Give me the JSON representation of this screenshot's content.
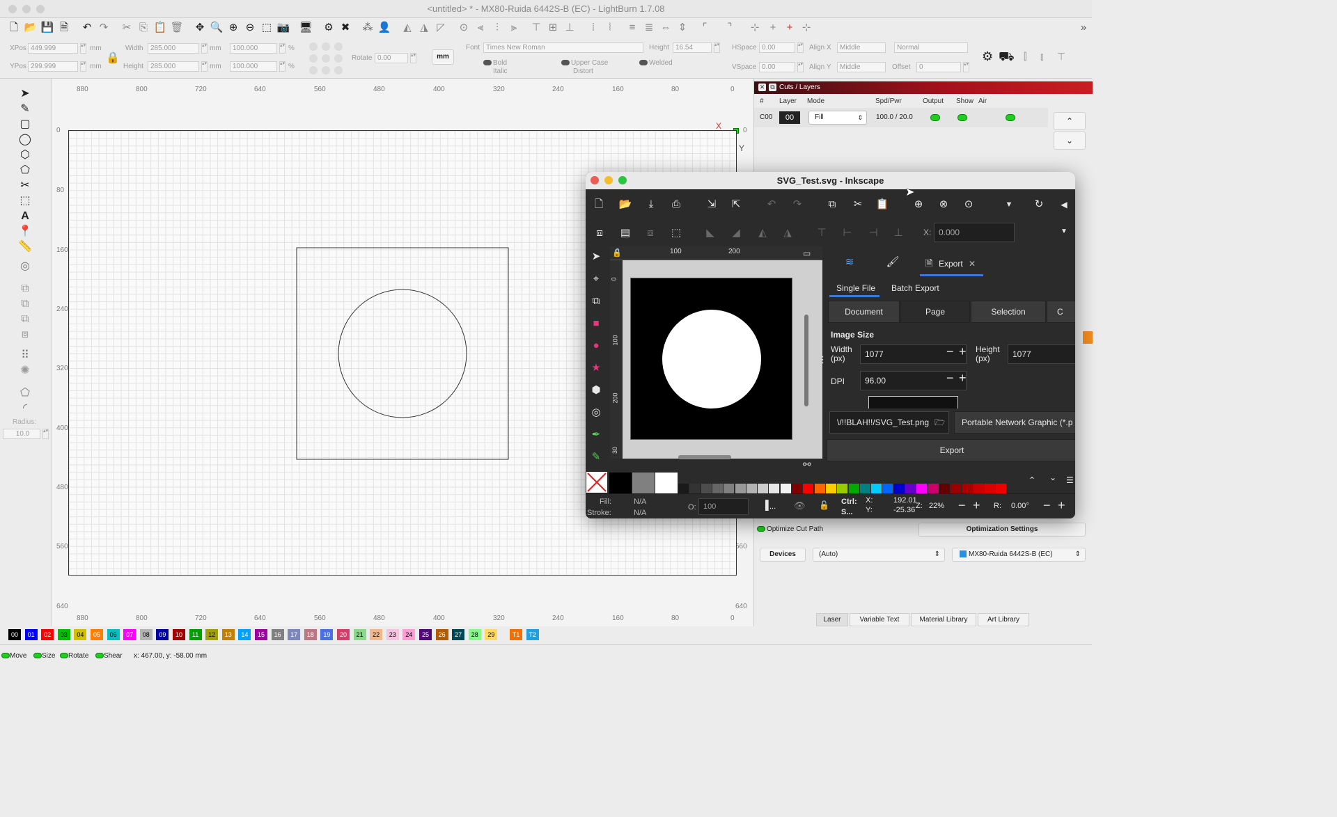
{
  "lightburn": {
    "title": "<untitled> * - MX80-Ruida 6442S-B (EC) - LightBurn 1.7.08",
    "numbar": {
      "xpos_label": "XPos",
      "xpos": "449.999",
      "ypos_label": "YPos",
      "ypos": "299.999",
      "unit_mm": "mm",
      "width_label": "Width",
      "width": "285.000",
      "height_label": "Height",
      "height": "285.000",
      "pct_w": "100.000",
      "pct_h": "100.000",
      "pct": "%",
      "rotate_label": "Rotate",
      "rotate": "0.00",
      "mm_button": "mm",
      "font_label": "Font",
      "font": "Times New Roman",
      "font_height_label": "Height",
      "font_height": "16.54",
      "hspace_label": "HSpace",
      "hspace": "0.00",
      "vspace_label": "VSpace",
      "vspace": "0.00",
      "alignx_label": "Align X",
      "alignx": "Middle",
      "aligny_label": "Align Y",
      "aligny": "Middle",
      "mode": "Normal",
      "offset_label": "Offset",
      "offset": "0",
      "bold": "Bold",
      "italic": "Italic",
      "upper": "Upper Case",
      "distort": "Distort",
      "welded": "Welded"
    },
    "ruler_top": [
      "880",
      "800",
      "720",
      "640",
      "560",
      "480",
      "400",
      "320",
      "240",
      "160",
      "80",
      "0"
    ],
    "ruler_bottom": [
      "880",
      "800",
      "720",
      "640",
      "560",
      "480",
      "400",
      "320",
      "240",
      "160",
      "80",
      "0"
    ],
    "ruler_left": [
      "0",
      "80",
      "160",
      "240",
      "320",
      "400",
      "480",
      "560",
      "640"
    ],
    "ruler_right": [
      "0",
      "560",
      "640"
    ],
    "axis_x": "X",
    "axis_y": "Y",
    "radius_label": "Radius:",
    "radius": "10.0",
    "cuts": {
      "title": "Cuts / Layers",
      "headers": [
        "#",
        "Layer",
        "Mode",
        "Spd/Pwr",
        "Output",
        "Show",
        "Air"
      ],
      "row": {
        "id": "C00",
        "layer": "00",
        "mode": "Fill",
        "spdpwr": "100.0 / 20.0"
      }
    },
    "optimize_label": "Optimize Cut Path",
    "optimization_settings": "Optimization Settings",
    "devices_button": "Devices",
    "devices_select": "(Auto)",
    "device_name": "MX80-Ruida 6442S-B (EC)",
    "tabs": [
      "Laser",
      "Variable Text",
      "Material Library",
      "Art Library"
    ],
    "palette": [
      {
        "label": "00",
        "color": "#000000"
      },
      {
        "label": "01",
        "color": "#0000ff"
      },
      {
        "label": "02",
        "color": "#ff0000"
      },
      {
        "label": "03",
        "color": "#00c000"
      },
      {
        "label": "04",
        "color": "#d0c000"
      },
      {
        "label": "05",
        "color": "#ff8000"
      },
      {
        "label": "06",
        "color": "#00c0c0"
      },
      {
        "label": "07",
        "color": "#ff00ff"
      },
      {
        "label": "08",
        "color": "#b4b4b4"
      },
      {
        "label": "09",
        "color": "#0000a0"
      },
      {
        "label": "10",
        "color": "#a00000"
      },
      {
        "label": "11",
        "color": "#00a000"
      },
      {
        "label": "12",
        "color": "#a0a000"
      },
      {
        "label": "13",
        "color": "#c08000"
      },
      {
        "label": "14",
        "color": "#00a0ff"
      },
      {
        "label": "15",
        "color": "#a000a0"
      },
      {
        "label": "16",
        "color": "#808080"
      },
      {
        "label": "17",
        "color": "#7d87b9"
      },
      {
        "label": "18",
        "color": "#bb7784"
      },
      {
        "label": "19",
        "color": "#4a6fe3"
      },
      {
        "label": "20",
        "color": "#d33f6a"
      },
      {
        "label": "21",
        "color": "#8cd78c"
      },
      {
        "label": "22",
        "color": "#f0b98d"
      },
      {
        "label": "23",
        "color": "#f6c4e1"
      },
      {
        "label": "24",
        "color": "#fa9ed4"
      },
      {
        "label": "25",
        "color": "#500a78"
      },
      {
        "label": "26",
        "color": "#b45a00"
      },
      {
        "label": "27",
        "color": "#004754"
      },
      {
        "label": "28",
        "color": "#86fa88"
      },
      {
        "label": "29",
        "color": "#ffdb66"
      },
      {
        "label": "T1",
        "color": "#f36f00"
      },
      {
        "label": "T2",
        "color": "#1fa0e0"
      }
    ],
    "status": {
      "move": "Move",
      "size": "Size",
      "rotate": "Rotate",
      "shear": "Shear",
      "coords": "x: 467.00, y: -58.00 mm"
    }
  },
  "inkscape": {
    "title": "SVG_Test.svg - Inkscape",
    "x_label": "X:",
    "x_value": "0.000",
    "ruler": [
      "0",
      "100",
      "200"
    ],
    "vruler": [
      "0",
      "100",
      "200",
      "30"
    ],
    "export_tab": "Export",
    "single_file": "Single File",
    "batch_export": "Batch Export",
    "area_buttons": [
      "Document",
      "Page",
      "Selection",
      "C"
    ],
    "image_size": "Image Size",
    "width_label": "Width (px)",
    "width": "1077",
    "height_label": "Height (px)",
    "height": "1077",
    "dpi_label": "DPI",
    "dpi": "96.00",
    "filename": "\\/!!BLAH!!/SVG_Test.png",
    "format": "Portable Network Graphic (*.p",
    "export_button": "Export",
    "fill_label": "Fill:",
    "fill": "N/A",
    "stroke_label": "Stroke:",
    "stroke": "N/A",
    "opacity_label": "O:",
    "opacity": "100",
    "ctrl": "Ctrl:",
    "ctrl2": "S...",
    "cx_label": "X:",
    "cx": "192.01",
    "cy_label": "Y:",
    "cy": "-25.36",
    "zoom_label": "Z:",
    "zoom": "22%",
    "rot_label": "R:",
    "rot": "0.00°",
    "ellipsis": "...",
    "swatches": [
      "#000000",
      "#808080",
      "#ffffff",
      "#1a1a1a",
      "#333333",
      "#4d4d4d",
      "#666666",
      "#808080",
      "#999999",
      "#b3b3b3",
      "#cccccc",
      "#e6e6e6",
      "#f2f2f2",
      "#800000",
      "#ff0000",
      "#ff6600",
      "#ffcc00",
      "#99cc00",
      "#00aa00",
      "#008080",
      "#00ccff",
      "#0066ff",
      "#0000cc",
      "#6600cc",
      "#ff00ff",
      "#cc0066",
      "#660000",
      "#990000",
      "#aa0000",
      "#cc0000",
      "#dd0000",
      "#ee0000"
    ]
  }
}
